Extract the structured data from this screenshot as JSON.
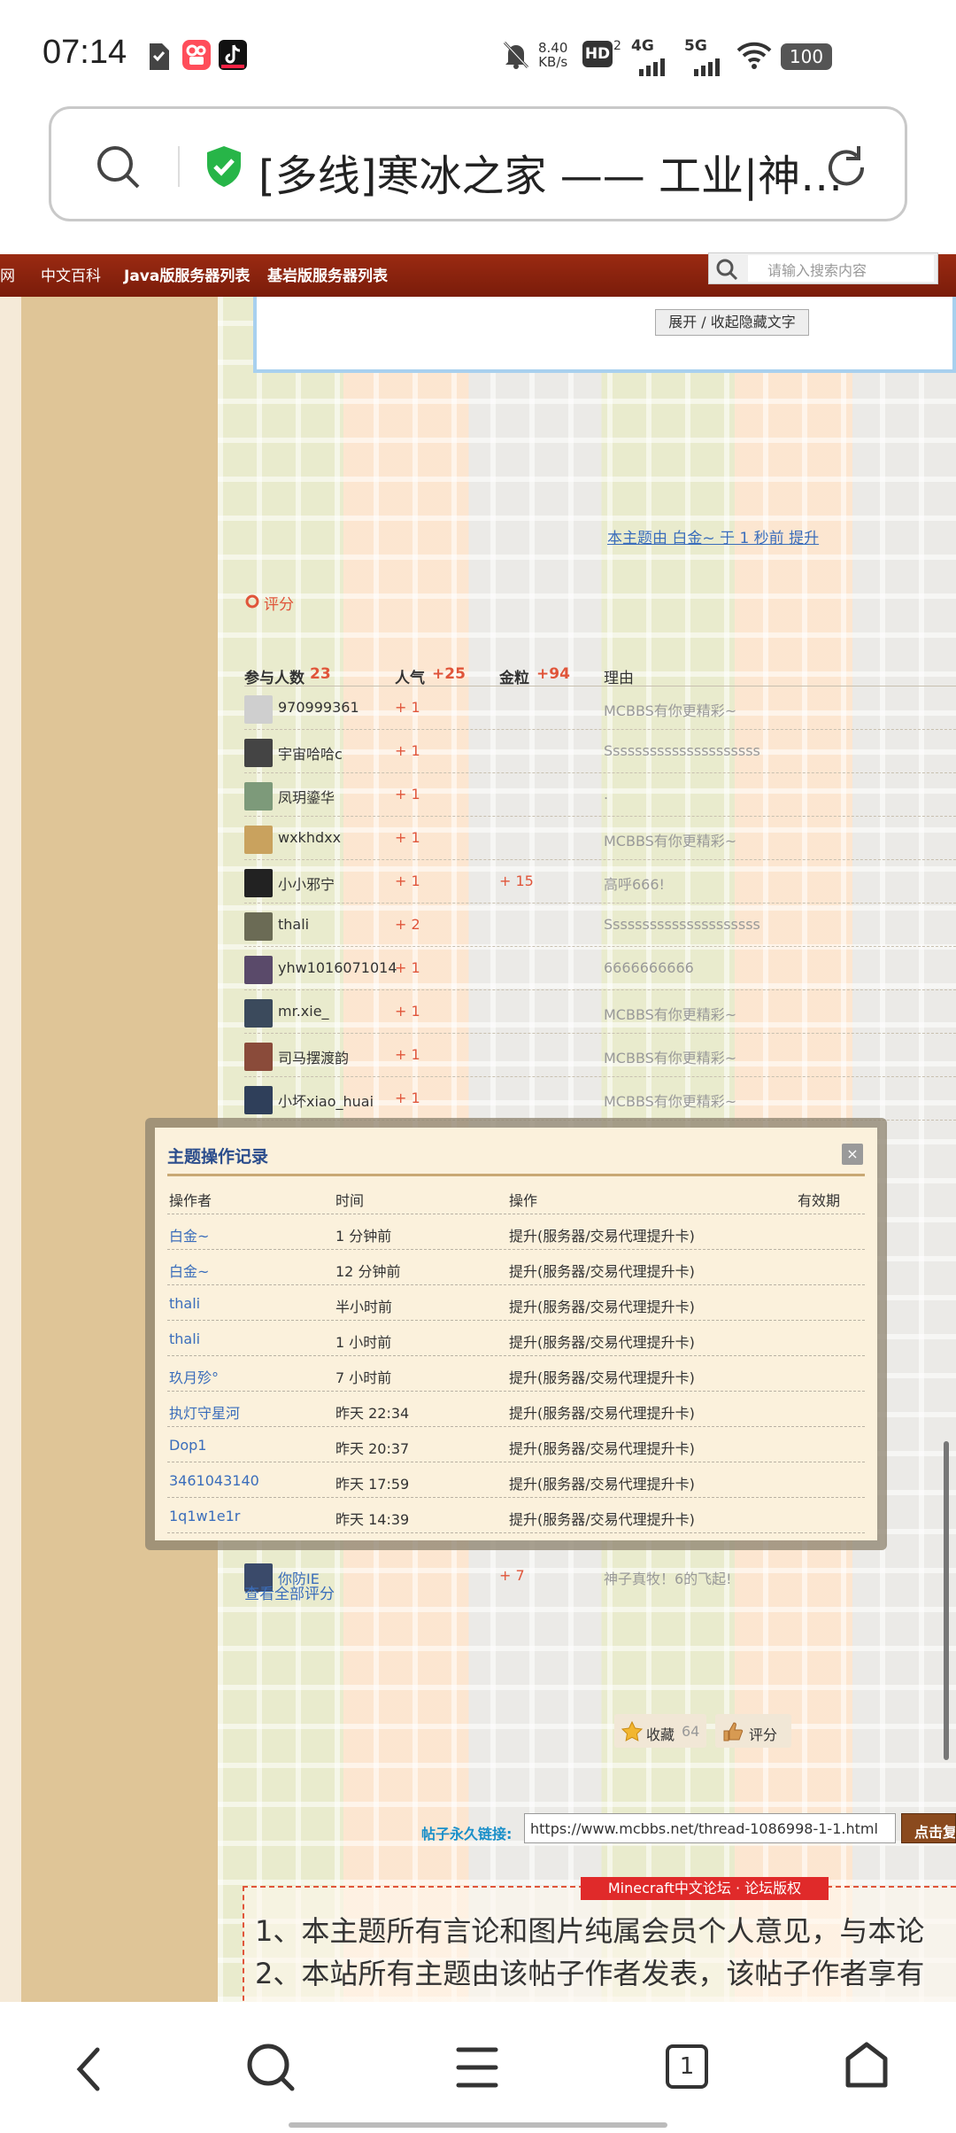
{
  "status_bar": {
    "time": "07:14",
    "net_speed_top": "8.40",
    "net_speed_bottom": "KB/s",
    "hd_badge": "HD",
    "hd_sub": "2",
    "sig1": "4G",
    "sig2": "5G",
    "battery": "100"
  },
  "browser": {
    "url_title": "[多线]寒冰之家 —— 工业|神…"
  },
  "site_nav": {
    "items": [
      "网",
      "中文百科",
      "Java版服务器列表",
      "基岩版服务器列表"
    ],
    "search_placeholder": "请输入搜索内容"
  },
  "post": {
    "toggle_hidden_label": "展开 / 收起隐藏文字",
    "bump_notice": "本主题由 白金~ 于 1 秒前 提升"
  },
  "rating": {
    "section_title": "评分",
    "columns": {
      "participants_label": "参与人数",
      "participants_count": "23",
      "popularity_label": "人气",
      "popularity_total": "+25",
      "gold_label": "金粒",
      "gold_total": "+94",
      "reason_label": "理由"
    },
    "rows": [
      {
        "name": "970999361",
        "pop": "+ 1",
        "gold": "",
        "reason": "MCBBS有你更精彩~"
      },
      {
        "name": "宇宙哈哈c",
        "pop": "+ 1",
        "gold": "",
        "reason": "Sssssssssssssssssssss"
      },
      {
        "name": "凤玥鎏华",
        "pop": "+ 1",
        "gold": "",
        "reason": "."
      },
      {
        "name": "wxkhdxx",
        "pop": "+ 1",
        "gold": "",
        "reason": "MCBBS有你更精彩~"
      },
      {
        "name": "小小邪宁",
        "pop": "+ 1",
        "gold": "+ 15",
        "reason": "高呼666!"
      },
      {
        "name": "thali",
        "pop": "+ 2",
        "gold": "",
        "reason": "Sssssssssssssssssssss"
      },
      {
        "name": "yhw1016071014",
        "pop": "+ 1",
        "gold": "",
        "reason": "6666666666"
      },
      {
        "name": "mr.xie_",
        "pop": "+ 1",
        "gold": "",
        "reason": "MCBBS有你更精彩~"
      },
      {
        "name": "司马摆渡韵",
        "pop": "+ 1",
        "gold": "",
        "reason": "MCBBS有你更精彩~"
      },
      {
        "name": "小坏xiao_huai",
        "pop": "+ 1",
        "gold": "",
        "reason": "MCBBS有你更精彩~"
      }
    ],
    "partial_row": {
      "name": "你防IE",
      "gold": "+ 7",
      "reason": "神子真牧！6的飞起!"
    },
    "view_all": "查看全部评分"
  },
  "actions": {
    "favorite_label": "收藏",
    "favorite_count": "64",
    "rate_label": "评分"
  },
  "permalink": {
    "label": "帖子永久链接:",
    "url": "https://www.mcbbs.net/thread-1086998-1-1.html",
    "copy_button": "点击复"
  },
  "copyright": {
    "tag": "Minecraft中文论坛 · 论坛版权",
    "line1": "1、本主题所有言论和图片纯属会员个人意见，与本论",
    "line2": "2、本站所有主题由该帖子作者发表，该帖子作者享有"
  },
  "dialog": {
    "title": "主题操作记录",
    "close": "×",
    "headers": [
      "操作者",
      "时间",
      "操作",
      "有效期"
    ],
    "rows": [
      {
        "user": "白金~",
        "time": "1 分钟前",
        "action": "提升(服务器/交易代理提升卡)",
        "expiry": ""
      },
      {
        "user": "白金~",
        "time": "12 分钟前",
        "action": "提升(服务器/交易代理提升卡)",
        "expiry": ""
      },
      {
        "user": "thali",
        "time": "半小时前",
        "action": "提升(服务器/交易代理提升卡)",
        "expiry": ""
      },
      {
        "user": "thali",
        "time": "1 小时前",
        "action": "提升(服务器/交易代理提升卡)",
        "expiry": ""
      },
      {
        "user": "玖月殄°",
        "time": "7 小时前",
        "action": "提升(服务器/交易代理提升卡)",
        "expiry": ""
      },
      {
        "user": "执灯守星河",
        "time": "昨天 22:34",
        "action": "提升(服务器/交易代理提升卡)",
        "expiry": ""
      },
      {
        "user": "Dop1",
        "time": "昨天 20:37",
        "action": "提升(服务器/交易代理提升卡)",
        "expiry": ""
      },
      {
        "user": "3461043140",
        "time": "昨天 17:59",
        "action": "提升(服务器/交易代理提升卡)",
        "expiry": ""
      },
      {
        "user": "1q1w1e1r",
        "time": "昨天 14:39",
        "action": "提升(服务器/交易代理提升卡)",
        "expiry": ""
      }
    ]
  },
  "bottom_nav": {
    "tab_count": "1"
  },
  "colors": {
    "nav_red": "#8a2410",
    "link_blue": "#3a6dbb",
    "accent_red": "#e0553a",
    "sidebar_tan": "#dfc597"
  },
  "avatar_colors": [
    "#cfcfcf",
    "#444444",
    "#7d9a7a",
    "#c9a25e",
    "#222222",
    "#6b6b55",
    "#5a4a6a",
    "#3b4a5c",
    "#8a4b3a",
    "#2f3f5a"
  ]
}
